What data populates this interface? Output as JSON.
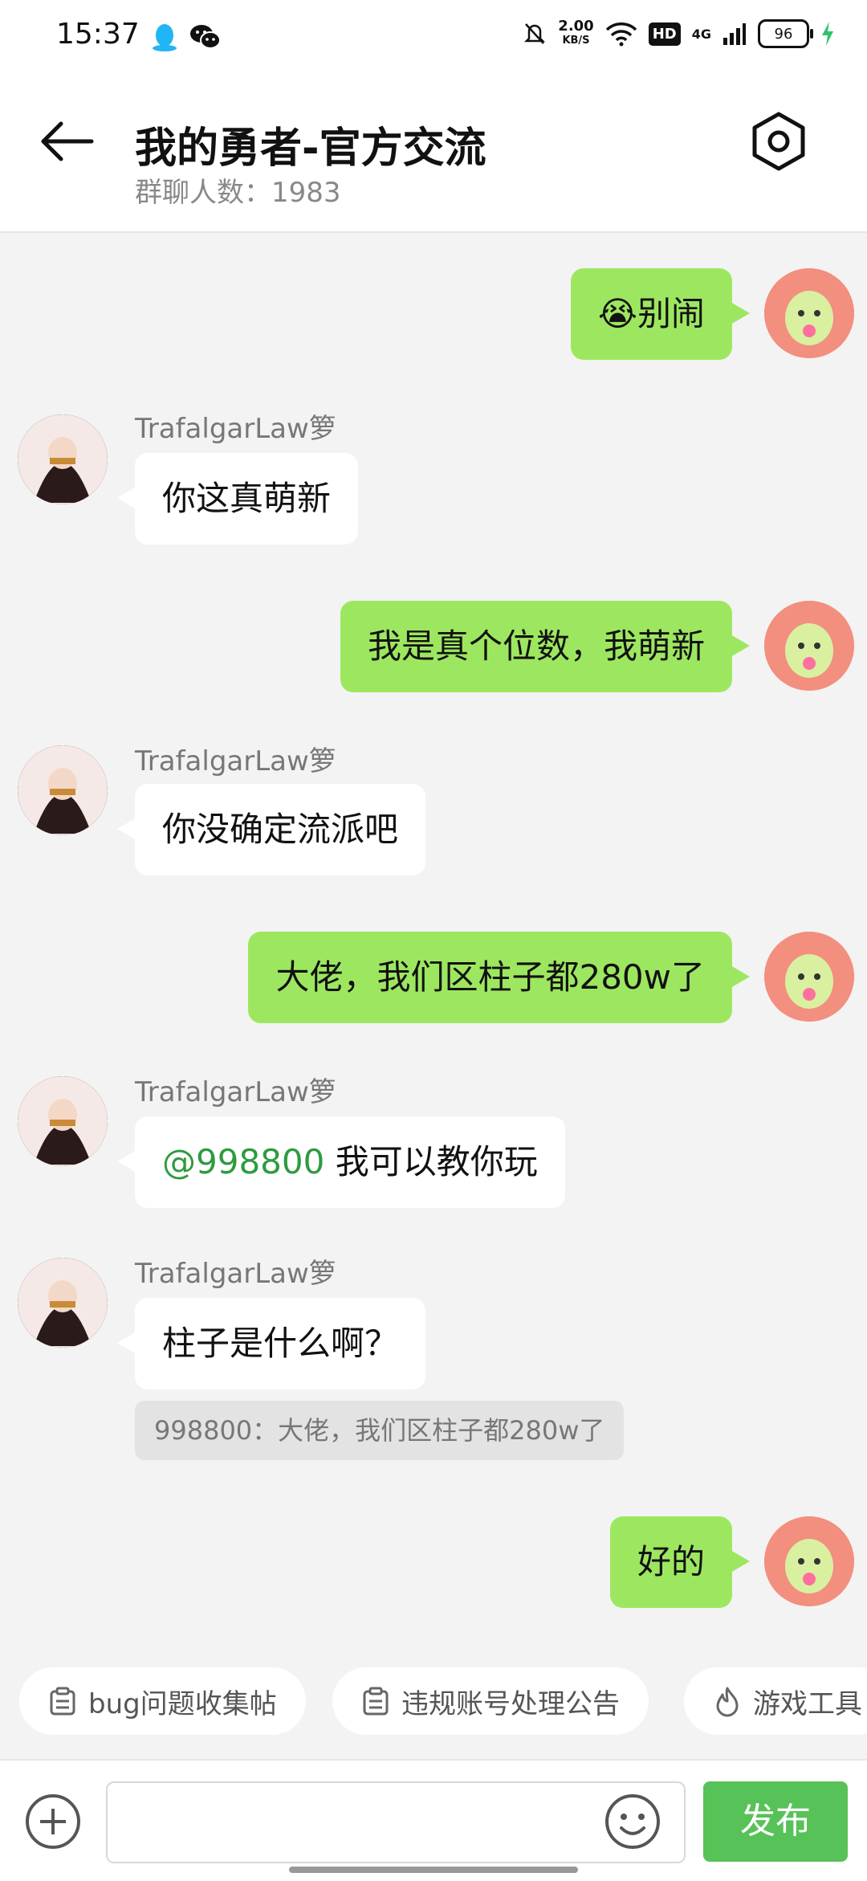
{
  "status_bar": {
    "time": "15:37",
    "speed_value": "2.00",
    "speed_unit": "KB/S",
    "hd": "HD",
    "network": "4G",
    "battery": "96",
    "icons": [
      "qq-icon",
      "wechat-icon",
      "mute-bell-icon",
      "wifi-icon",
      "signal-icon",
      "charging-icon"
    ]
  },
  "header": {
    "title": "我的勇者-官方交流",
    "subtitle": "群聊人数：1983"
  },
  "messages": [
    {
      "side": "me",
      "text": "😭别闹"
    },
    {
      "side": "other",
      "sender": "TrafalgarLaw箩",
      "text": "你这真萌新"
    },
    {
      "side": "me",
      "text": "我是真个位数，我萌新"
    },
    {
      "side": "other",
      "sender": "TrafalgarLaw箩",
      "text": "你没确定流派吧"
    },
    {
      "side": "me",
      "text": "大佬，我们区柱子都280w了"
    },
    {
      "side": "other",
      "sender": "TrafalgarLaw箩",
      "mention": "@998800",
      "text": " 我可以教你玩"
    },
    {
      "side": "other",
      "sender": "TrafalgarLaw箩",
      "text": "柱子是什么啊？",
      "quote": "998800：大佬，我们区柱子都280w了"
    },
    {
      "side": "me",
      "text": "好的"
    }
  ],
  "quick_links": [
    {
      "label": "bug问题收集帖",
      "icon": "clipboard-icon"
    },
    {
      "label": "违规账号处理公告",
      "icon": "clipboard-icon"
    },
    {
      "label": "游戏工具",
      "icon": "fire-icon"
    }
  ],
  "input_bar": {
    "placeholder": "",
    "send_label": "发布"
  },
  "colors": {
    "my_bubble": "#9de760",
    "other_bubble": "#ffffff",
    "send_button": "#57c257",
    "mention": "#2e9b3e"
  }
}
